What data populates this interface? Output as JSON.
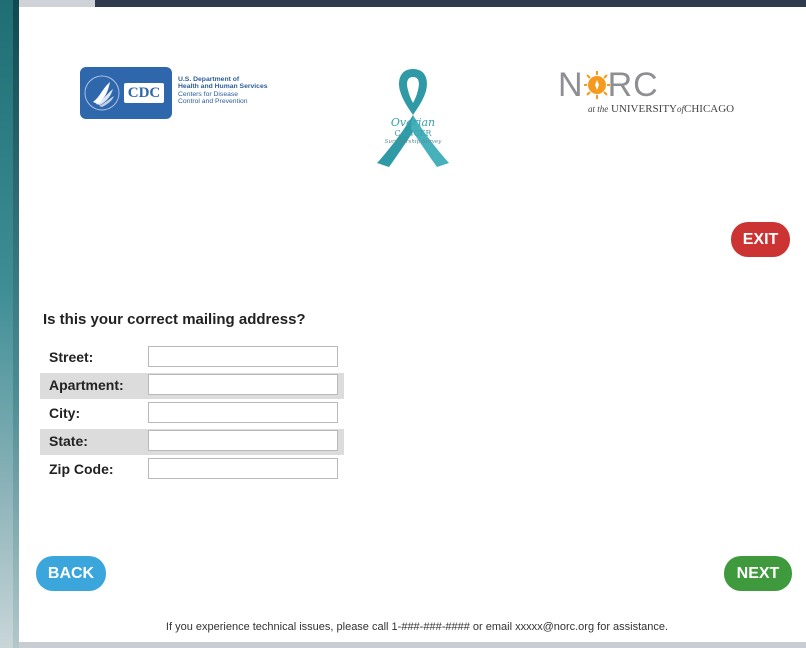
{
  "header": {
    "cdc_badge": "CDC",
    "hhs_lines": [
      "U.S. Department of",
      "Health and Human Services",
      "Centers for Disease",
      "Control and Prevention"
    ],
    "survey_logo": {
      "line1": "Ovarian",
      "line2": "CANCER",
      "line3": "Survivorship Survey"
    },
    "norc": {
      "name_left": "N",
      "name_right": "RC",
      "subtitle_pre": "at the",
      "subtitle_mid": "UNIVERSITY",
      "subtitle_of": "of",
      "subtitle_end": "CHICAGO"
    }
  },
  "buttons": {
    "exit": "EXIT",
    "back": "BACK",
    "next": "NEXT"
  },
  "form": {
    "question": "Is this your correct mailing address?",
    "fields": [
      {
        "label": "Street:",
        "value": ""
      },
      {
        "label": "Apartment:",
        "value": ""
      },
      {
        "label": "City:",
        "value": ""
      },
      {
        "label": "State:",
        "value": ""
      },
      {
        "label": "Zip Code:",
        "value": ""
      }
    ]
  },
  "footer": {
    "text": "If you experience technical issues, please call 1-###-###-#### or email xxxxx@norc.org for assistance."
  },
  "colors": {
    "exit": "#cc3333",
    "back": "#3aa6dc",
    "next": "#3f9a3e",
    "ribbon": "#3aa0ad",
    "cdc_blue": "#2f67ad"
  }
}
